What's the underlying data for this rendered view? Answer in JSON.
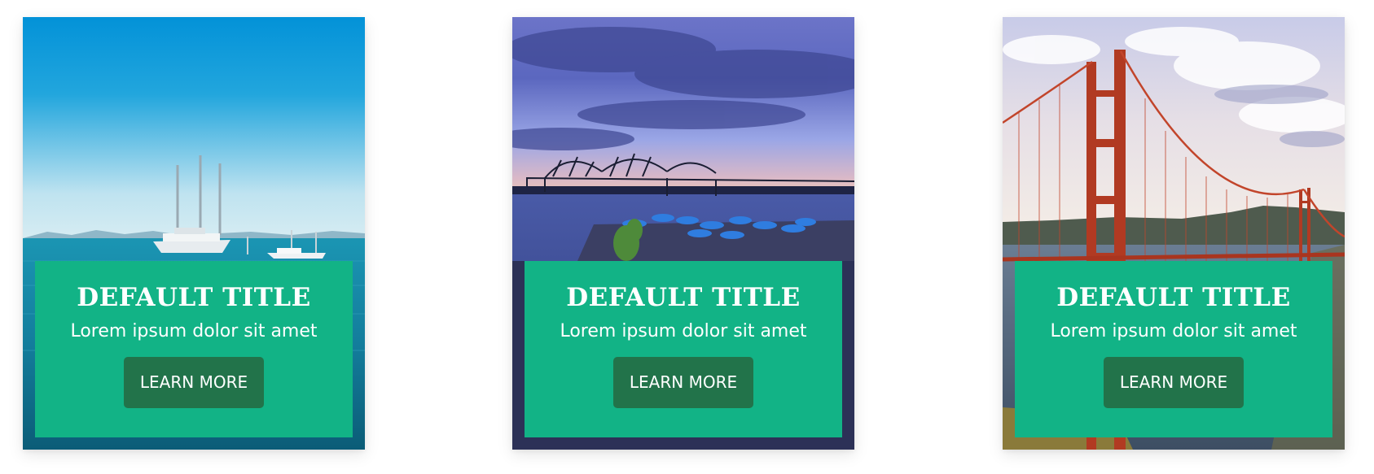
{
  "cards": [
    {
      "image_alt": "Sailing yacht on blue sea",
      "title": "DEFAULT TITLE",
      "text": "Lorem ipsum dolor sit amet",
      "button_label": "LEARN MORE"
    },
    {
      "image_alt": "Bridge over river at dusk with blue umbrellas",
      "title": "DEFAULT TITLE",
      "text": "Lorem ipsum dolor sit amet",
      "button_label": "LEARN MORE"
    },
    {
      "image_alt": "Golden Gate Bridge under cloudy sky",
      "title": "DEFAULT TITLE",
      "text": "Lorem ipsum dolor sit amet",
      "button_label": "LEARN MORE"
    }
  ],
  "colors": {
    "overlay": "#12b386",
    "button": "#22734a",
    "text": "#ffffff"
  }
}
